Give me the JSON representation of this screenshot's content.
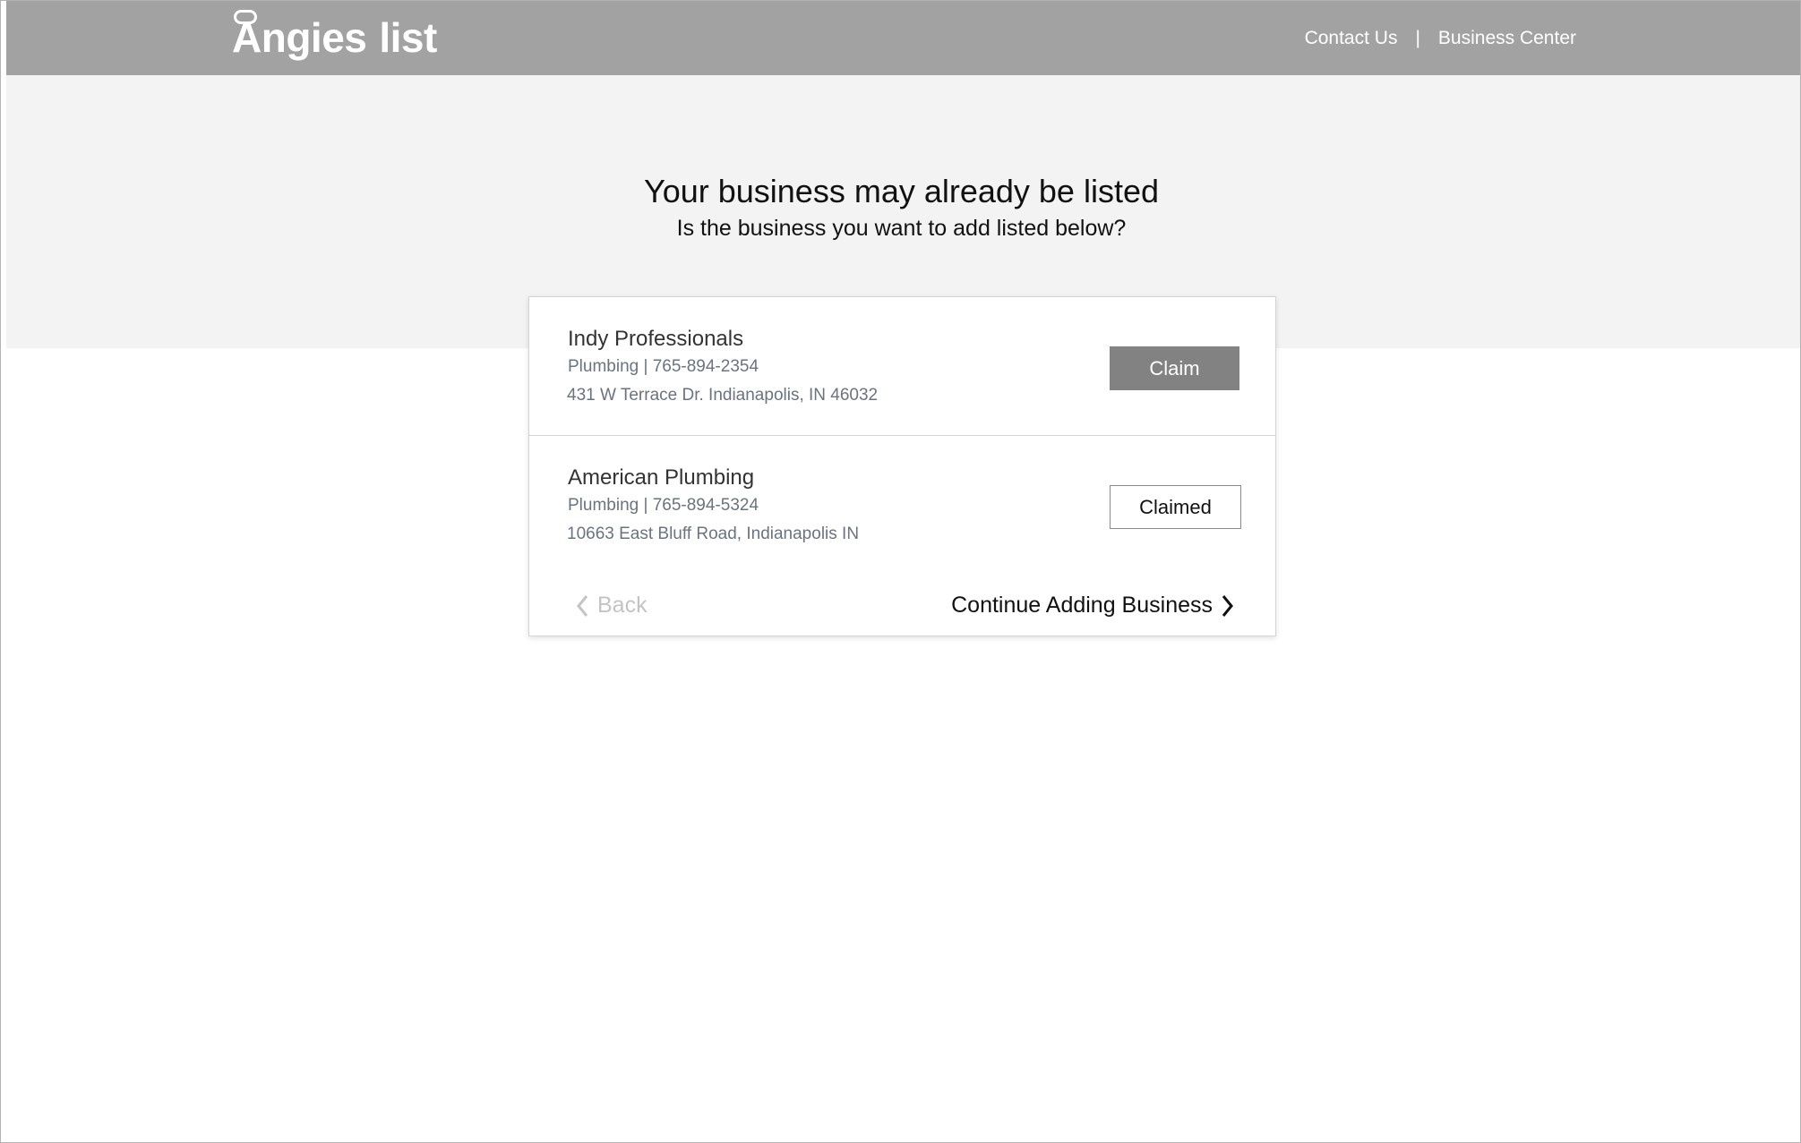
{
  "header": {
    "logo_text_1": "Angies",
    "logo_text_2": "list",
    "nav": {
      "contact_label": "Contact Us",
      "separator": "|",
      "business_center_label": "Business Center"
    }
  },
  "hero": {
    "title": "Your business may already be listed",
    "subtitle": "Is the business you want to add listed below?"
  },
  "results": [
    {
      "name": "Indy Professionals",
      "meta": "Plumbing | 765-894-2354",
      "address": "431 W Terrace Dr. Indianapolis, IN 46032",
      "action_label": "Claim",
      "status": "claimable"
    },
    {
      "name": "American Plumbing",
      "meta": "Plumbing | 765-894-5324",
      "address": "10663 East Bluff Road, Indianapolis IN",
      "action_label": "Claimed",
      "status": "claimed"
    }
  ],
  "footer": {
    "back_label": "Back",
    "continue_label": "Continue Adding Business"
  },
  "icons": {
    "back": "chevron-left-icon",
    "continue": "chevron-right-icon"
  },
  "colors": {
    "header_bg": "#a2a2a2",
    "hero_bg": "#f3f3f3",
    "claim_button_bg": "#828282",
    "meta_text": "#6b7380",
    "back_text_disabled": "#c4c4c4"
  }
}
